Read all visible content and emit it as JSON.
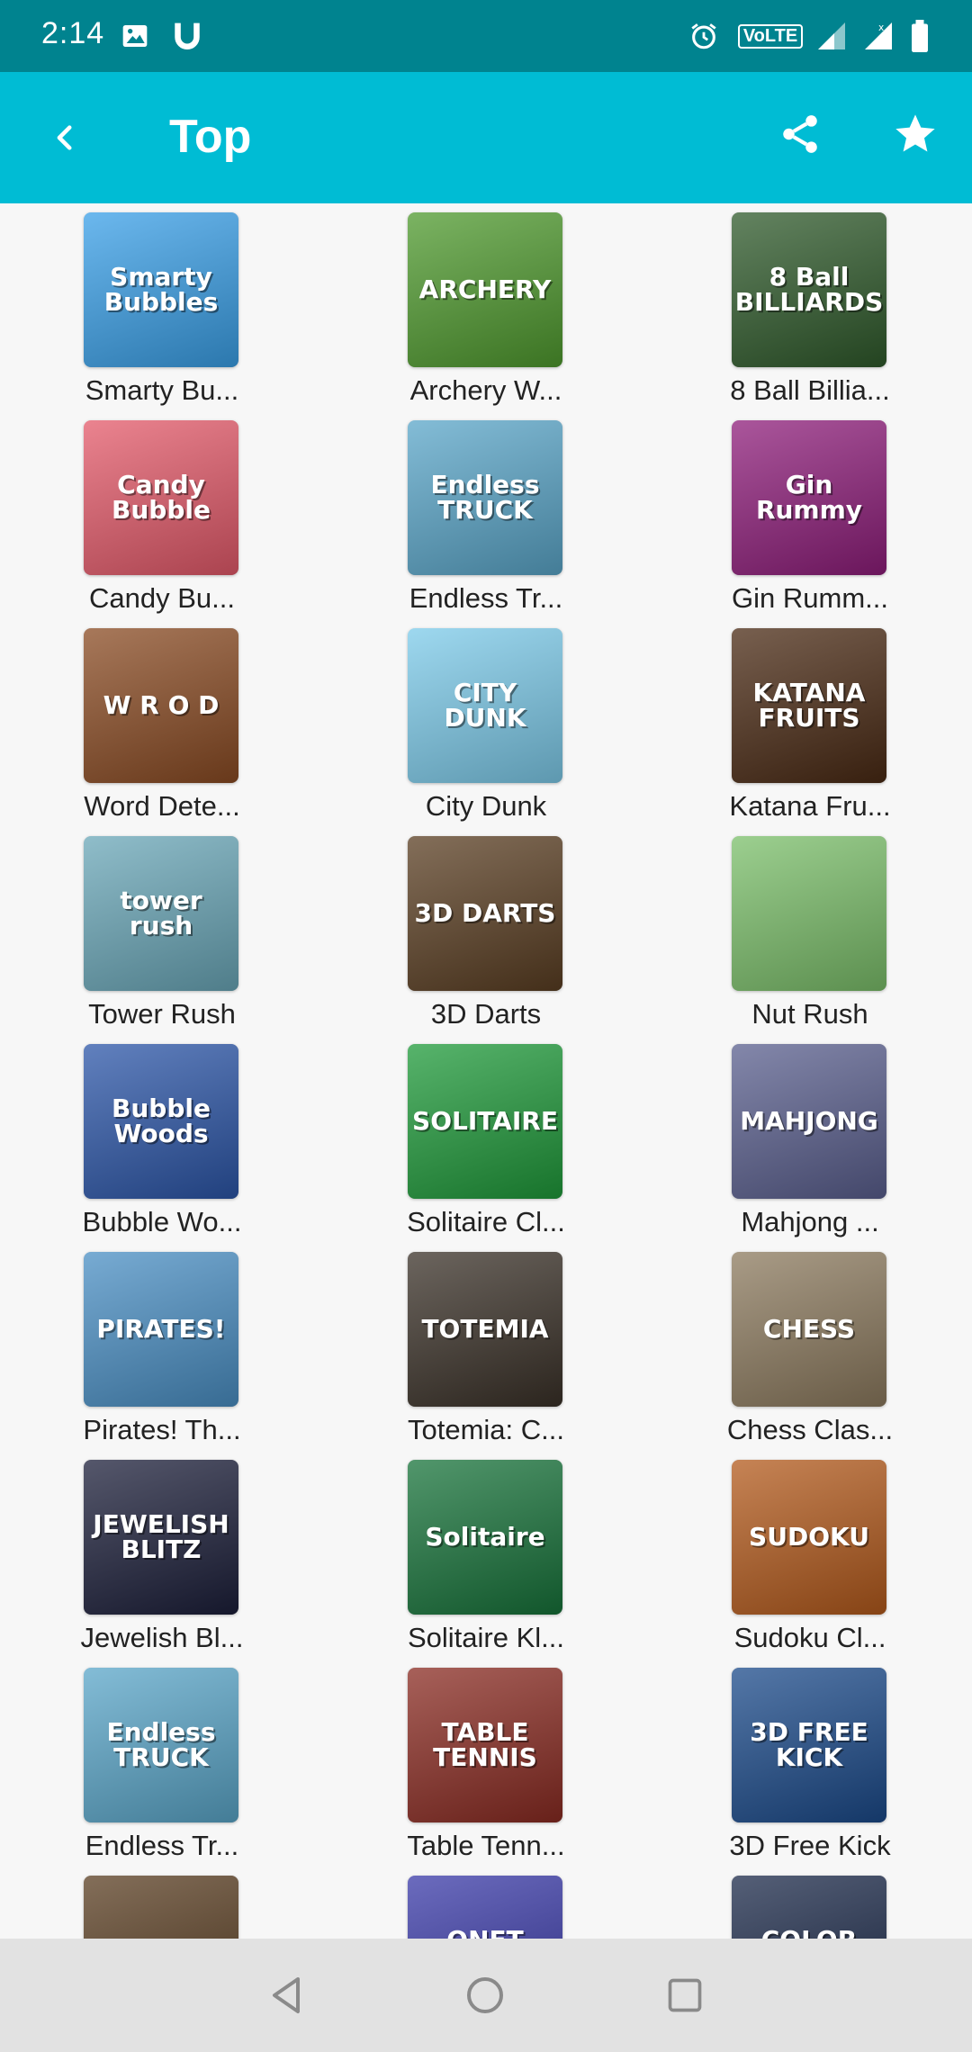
{
  "status_bar": {
    "time": "2:14",
    "network_badge": "VoLTE",
    "icons": [
      "image-icon",
      "u-app-icon",
      "alarm-icon",
      "volte-icon",
      "signal-icon",
      "signal-icon",
      "battery-icon"
    ]
  },
  "app_bar": {
    "title": "Top",
    "back_icon": "chevron-left-icon",
    "share_icon": "share-icon",
    "favorite_icon": "star-icon",
    "color": "#00bcd4"
  },
  "games": [
    {
      "label": "Smarty Bu...",
      "art": "Smarty Bubbles",
      "color": "#3aa0e8"
    },
    {
      "label": "Archery W...",
      "art": "ARCHERY",
      "color": "#4f9a2e"
    },
    {
      "label": "8 Ball Billia...",
      "art": "8 Ball BILLIARDS",
      "color": "#2f5a2b"
    },
    {
      "label": "Candy Bu...",
      "art": "Candy Bubble",
      "color": "#e45a6a"
    },
    {
      "label": "Endless Tr...",
      "art": "Endless TRUCK",
      "color": "#5aa6c9"
    },
    {
      "label": "Gin Rumm...",
      "art": "Gin Rummy",
      "color": "#8e1d7a"
    },
    {
      "label": "Word Dete...",
      "art": "W R O D",
      "color": "#8a4b23"
    },
    {
      "label": "City Dunk",
      "art": "CITY DUNK",
      "color": "#7dcbea"
    },
    {
      "label": "Katana Fru...",
      "art": "KATANA FRUITS",
      "color": "#4a2a14"
    },
    {
      "label": "Tower Rush",
      "art": "tower rush",
      "color": "#6aa7b8"
    },
    {
      "label": "3D Darts",
      "art": "3D DARTS",
      "color": "#5a3e22"
    },
    {
      "label": "Nut Rush",
      "art": "",
      "color": "#7bbf6a"
    },
    {
      "label": "Bubble Wo...",
      "art": "Bubble Woods",
      "color": "#2c56a8"
    },
    {
      "label": "Solitaire Cl...",
      "art": "SOLITAIRE",
      "color": "#1f9a3a"
    },
    {
      "label": "Mahjong ...",
      "art": "MAHJONG",
      "color": "#5a5f8e"
    },
    {
      "label": "Pirates! Th...",
      "art": "PIRATES!",
      "color": "#4a8fc4"
    },
    {
      "label": "Totemia: C...",
      "art": "TOTEMIA",
      "color": "#3a3128"
    },
    {
      "label": "Chess Clas...",
      "art": "CHESS",
      "color": "#8c7a5e"
    },
    {
      "label": "Jewelish Bl...",
      "art": "JEWELISH BLITZ",
      "color": "#1c1f3a"
    },
    {
      "label": "Solitaire Kl...",
      "art": "Solitaire",
      "color": "#17733a"
    },
    {
      "label": "Sudoku Cl...",
      "art": "SUDOKU",
      "color": "#b35a1c"
    },
    {
      "label": "Endless Tr...",
      "art": "Endless TRUCK",
      "color": "#5aa6c9"
    },
    {
      "label": "Table Tenn...",
      "art": "TABLE TENNIS",
      "color": "#8a2b22"
    },
    {
      "label": "3D Free Kick",
      "art": "3D FREE KICK",
      "color": "#1b4a8a"
    },
    {
      "label": "",
      "art": "",
      "color": "#5a3e22"
    },
    {
      "label": "",
      "art": "ONET CONNECT",
      "color": "#3a3aa8"
    },
    {
      "label": "",
      "art": "COLOR SHAPE",
      "color": "#1c2a4a"
    }
  ],
  "nav_bar": {
    "back_icon": "triangle-back-icon",
    "home_icon": "circle-home-icon",
    "recents_icon": "square-recents-icon"
  }
}
